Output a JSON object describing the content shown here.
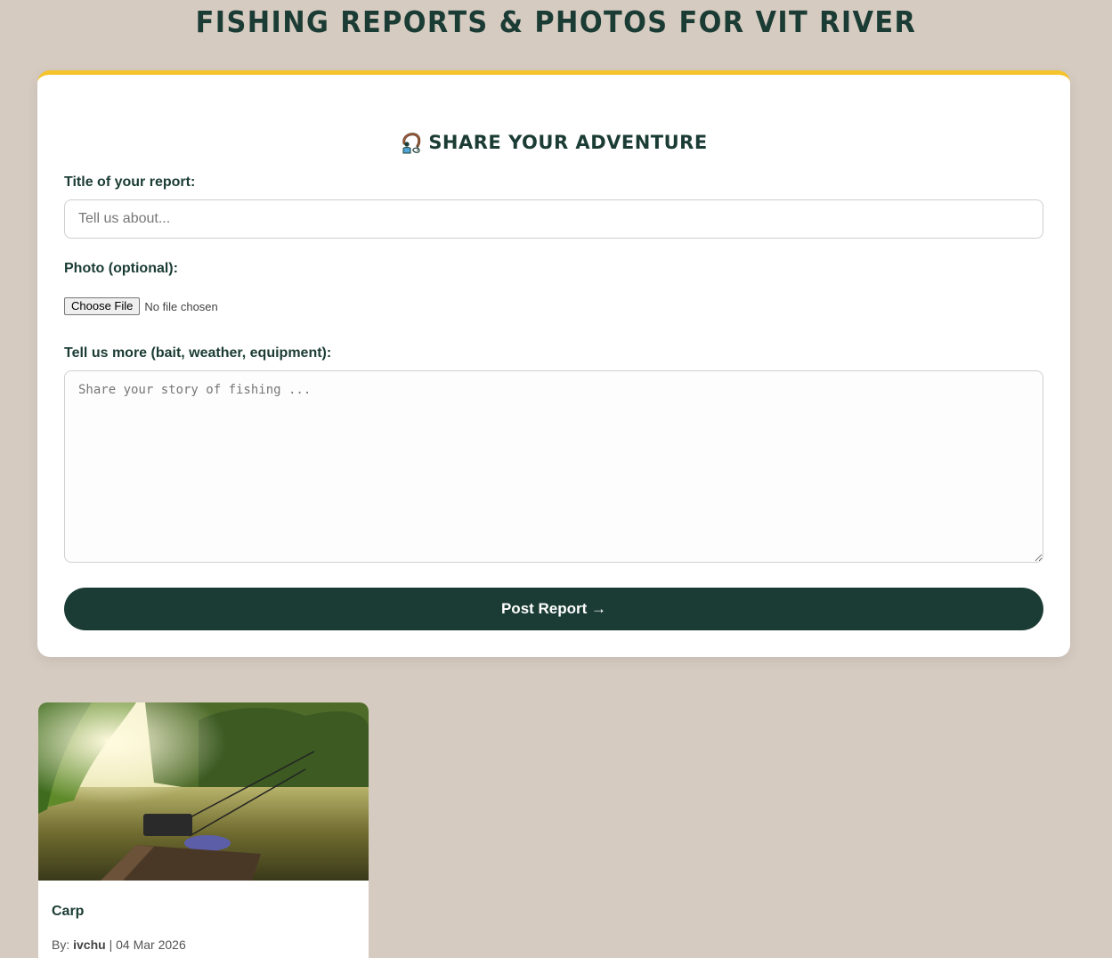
{
  "header": {
    "title": "FISHING REPORTS & PHOTOS FOR VIT RIVER"
  },
  "form": {
    "heading": "SHARE YOUR ADVENTURE",
    "heading_icon": "fisherman-icon",
    "title_label": "Title of your report:",
    "title_placeholder": "Tell us about...",
    "title_value": "",
    "photo_label": "Photo (optional):",
    "file_button_label": "Choose File",
    "file_status": "No file chosen",
    "details_label": "Tell us more (bait, weather, equipment):",
    "details_placeholder": "Share your story of fishing ...",
    "details_value": "",
    "submit_label": "Post Report →"
  },
  "reports": [
    {
      "title": "Carp",
      "by_label": "By:",
      "author": "ivchu",
      "separator": "|",
      "date": "04 Mar 2026",
      "photo_icon": "river-fishing-photo"
    }
  ],
  "colors": {
    "background": "#d6cbc1",
    "primary": "#1b3c34",
    "accent": "#f5c32c",
    "card": "#ffffff"
  }
}
